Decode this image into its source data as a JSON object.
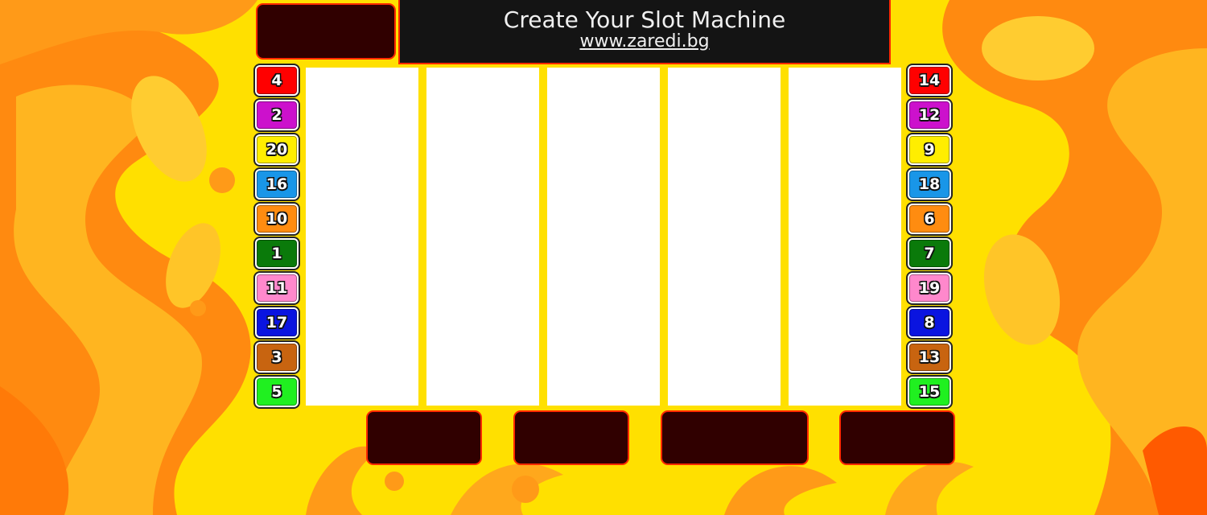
{
  "header": {
    "title": "Create Your Slot Machine",
    "link": "www.zaredi.bg"
  },
  "reels": [
    "",
    "",
    "",
    "",
    ""
  ],
  "left_lines": [
    {
      "label": "4",
      "color": "#ff0000"
    },
    {
      "label": "2",
      "color": "#cc11cc"
    },
    {
      "label": "20",
      "color": "#ffee00"
    },
    {
      "label": "16",
      "color": "#1996e8"
    },
    {
      "label": "10",
      "color": "#ff8c10"
    },
    {
      "label": "1",
      "color": "#0a7a0a"
    },
    {
      "label": "11",
      "color": "#ff88cc"
    },
    {
      "label": "17",
      "color": "#0a14e0"
    },
    {
      "label": "3",
      "color": "#c86410"
    },
    {
      "label": "5",
      "color": "#20f020"
    }
  ],
  "right_lines": [
    {
      "label": "14",
      "color": "#ff0000"
    },
    {
      "label": "12",
      "color": "#cc11cc"
    },
    {
      "label": "9",
      "color": "#ffee00"
    },
    {
      "label": "18",
      "color": "#1996e8"
    },
    {
      "label": "6",
      "color": "#ff8c10"
    },
    {
      "label": "7",
      "color": "#0a7a0a"
    },
    {
      "label": "19",
      "color": "#ff88cc"
    },
    {
      "label": "8",
      "color": "#0a14e0"
    },
    {
      "label": "13",
      "color": "#c86410"
    },
    {
      "label": "15",
      "color": "#20f020"
    }
  ],
  "colors": {
    "background": "#ffe000",
    "panel": "#300000",
    "panel_border": "#ff2a00",
    "title_bg": "#141414"
  }
}
